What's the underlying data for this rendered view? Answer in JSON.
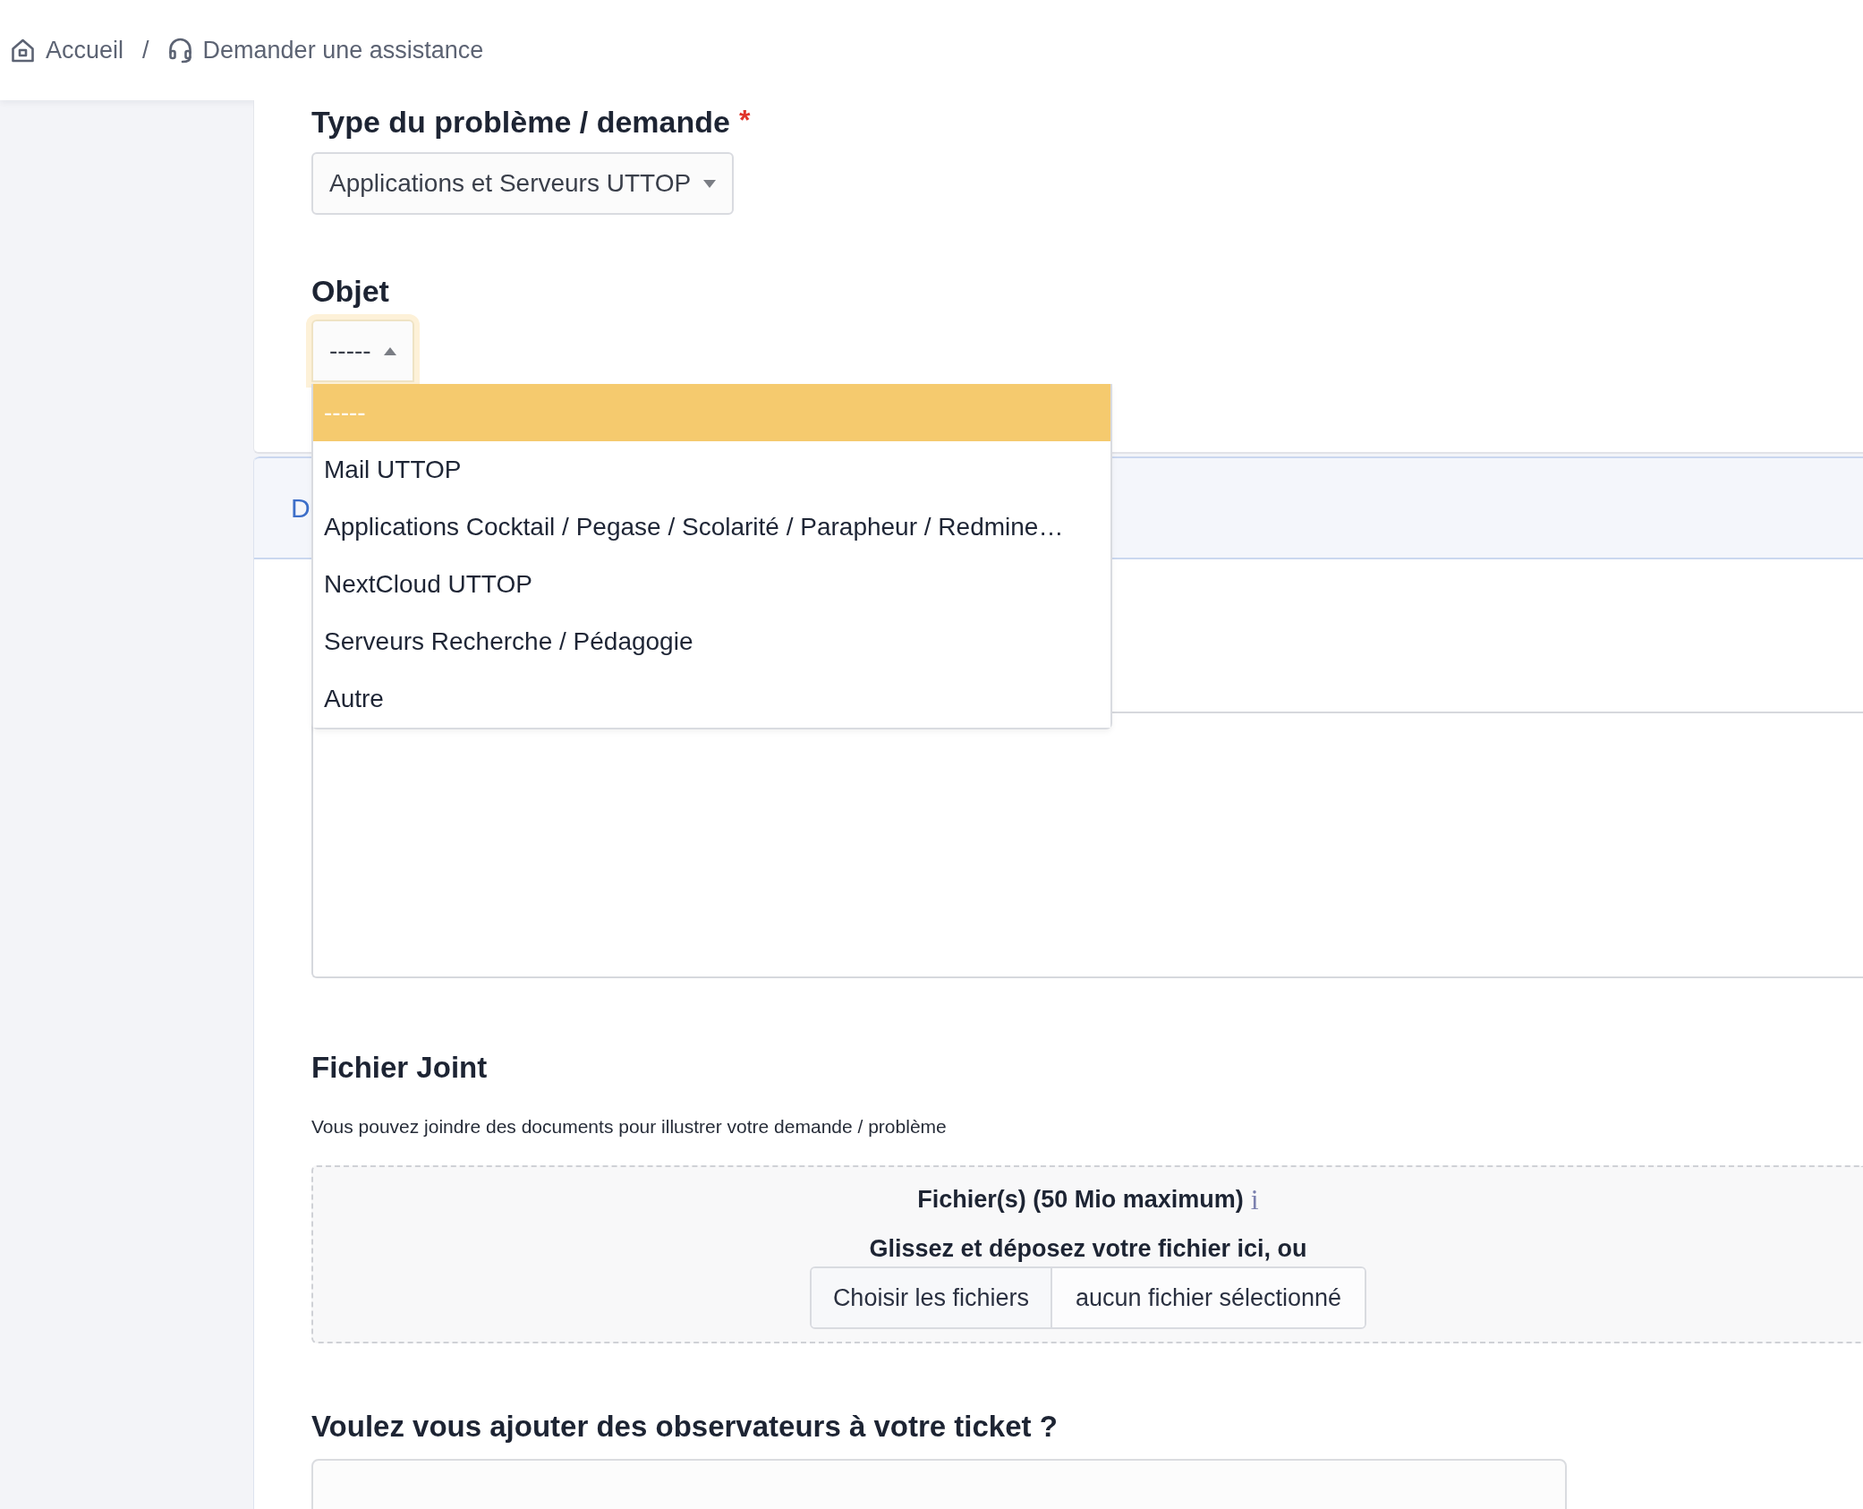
{
  "breadcrumb": {
    "separator": "/",
    "items": [
      {
        "kind": "home",
        "label": "Accueil"
      },
      {
        "kind": "support",
        "label": "Demander une assistance"
      }
    ]
  },
  "type_field": {
    "label": "Type du problème / demande",
    "required_mark": "*",
    "value": "Applications et Serveurs UTTOP",
    "expanded": false
  },
  "object_field": {
    "label": "Objet",
    "value": "-----",
    "expanded": true,
    "options": [
      {
        "label": "-----",
        "selected": true
      },
      {
        "label": "Mail UTTOP",
        "selected": false
      },
      {
        "label": "Applications Cocktail / Pegase / Scolarité / Parapheur / Redmine…",
        "selected": false
      },
      {
        "label": "NextCloud UTTOP",
        "selected": false
      },
      {
        "label": "Serveurs Recherche / Pédagogie",
        "selected": false
      },
      {
        "label": "Autre",
        "selected": false
      }
    ]
  },
  "section_header": {
    "title": "D"
  },
  "attachment": {
    "title": "Fichier Joint",
    "help": "Vous pouvez joindre des documents pour illustrer votre demande / problème",
    "dropzone_title": "Fichier(s) (50 Mio maximum)",
    "info_mark": "i",
    "dropzone_hint": "Glissez et déposez votre fichier ici, ou",
    "choose_button": "Choisir les fichiers",
    "file_status": "aucun fichier sélectionné"
  },
  "observers": {
    "title": "Voulez vous ajouter des observateurs à votre ticket ?"
  }
}
